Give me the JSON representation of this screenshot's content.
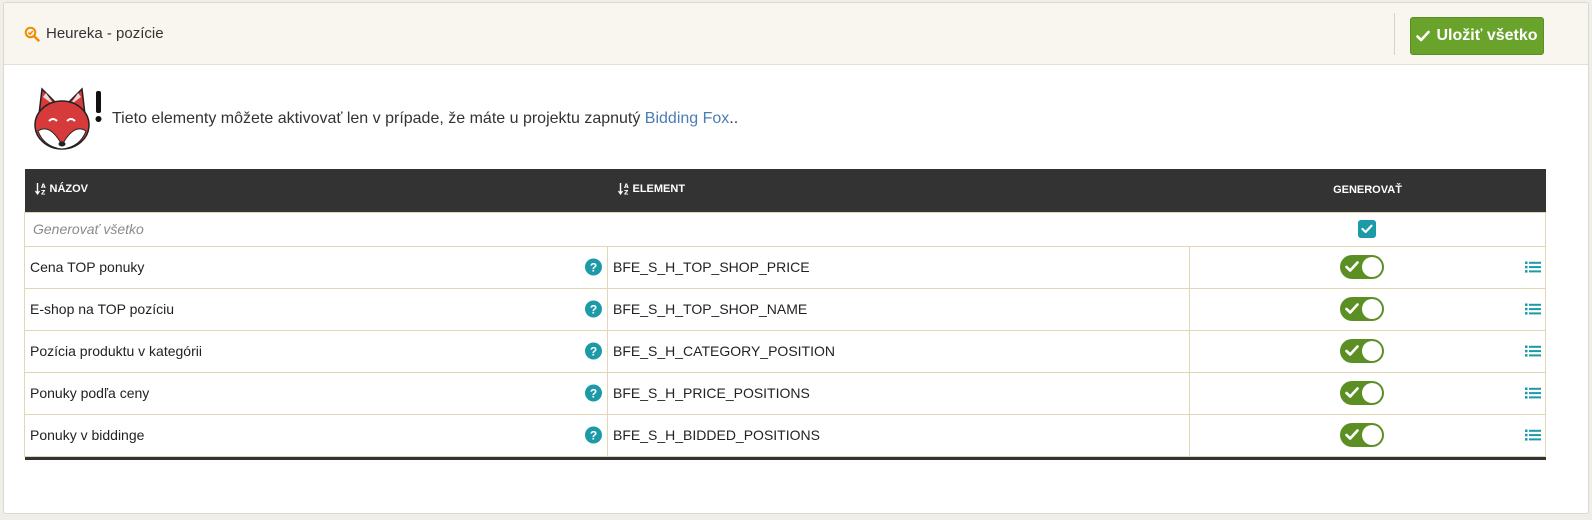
{
  "header": {
    "title": "Heureka - pozície",
    "save_label": "Uložiť všetko"
  },
  "notice": {
    "text": "Tieto elementy môžete aktivovať len v prípade, že máte u projektu zapnutý ",
    "link_text": "Bidding Fox",
    "suffix": ".."
  },
  "table": {
    "columns": {
      "name": "NÁZOV",
      "element": "ELEMENT",
      "generate": "GENEROVAŤ"
    },
    "generate_all_label": "Generovať všetko",
    "generate_all_checked": true,
    "rows": [
      {
        "name": "Cena TOP ponuky",
        "element": "BFE_S_H_TOP_SHOP_PRICE",
        "enabled": true
      },
      {
        "name": "E-shop na TOP pozíciu",
        "element": "BFE_S_H_TOP_SHOP_NAME",
        "enabled": true
      },
      {
        "name": "Pozícia produktu v kategórii",
        "element": "BFE_S_H_CATEGORY_POSITION",
        "enabled": true
      },
      {
        "name": "Ponuky podľa ceny",
        "element": "BFE_S_H_PRICE_POSITIONS",
        "enabled": true
      },
      {
        "name": "Ponuky v biddinge",
        "element": "BFE_S_H_BIDDED_POSITIONS",
        "enabled": true
      }
    ]
  },
  "colors": {
    "accent_green": "#6aa32c",
    "toggle_green": "#5b8f23",
    "teal": "#1c9aa8",
    "header_dark": "#333333",
    "link_blue": "#4a7db5",
    "heureka_orange": "#f08c00"
  },
  "icons": {
    "title_icon": "heureka-search-icon",
    "save_icon": "check-icon",
    "sort_icon": "sort-alpha-icon",
    "help_icon": "question-circle-icon",
    "row_action_icon": "list-icon",
    "mascot": "fox-mascot"
  }
}
